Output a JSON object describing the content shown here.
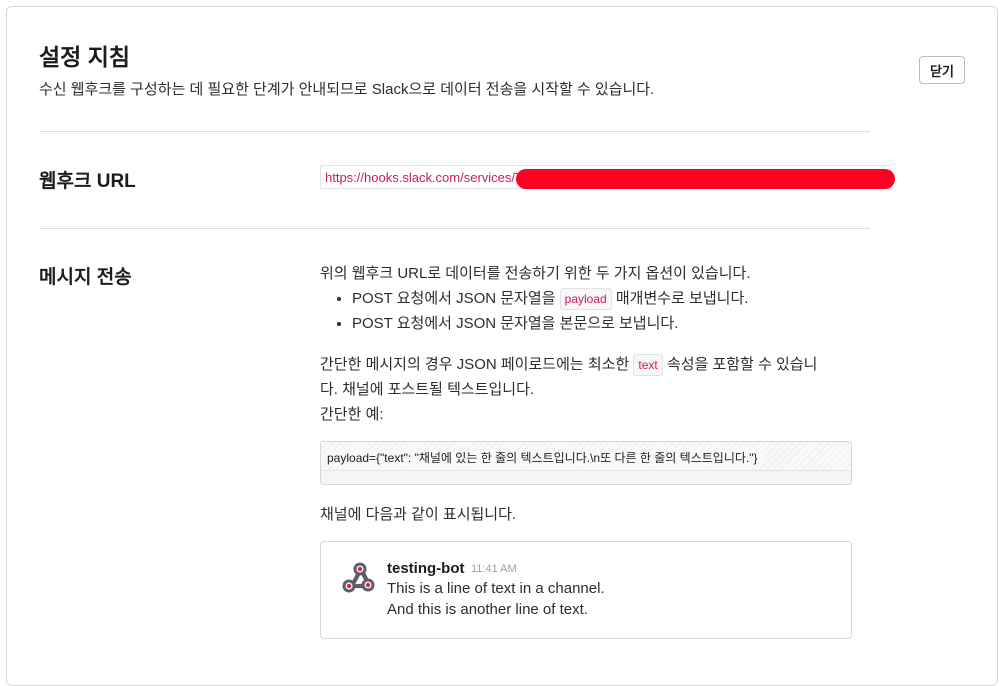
{
  "header": {
    "title": "설정 지침",
    "subtitle": "수신 웹후크를 구성하는 데 필요한 단계가 안내되므로 Slack으로 데이터 전송을 시작할 수 있습니다.",
    "close_label": "닫기"
  },
  "webhook": {
    "heading": "웹후크 URL",
    "url": "https://hooks.slack.com/services/T"
  },
  "send": {
    "heading": "메시지 전송",
    "intro": "위의 웹후크 URL로 데이터를 전송하기 위한 두 가지 옵션이 있습니다.",
    "bullet1_pre": "POST 요청에서 JSON 문자열을",
    "bullet1_code": "payload",
    "bullet1_post": "매개변수로 보냅니다.",
    "bullet2": "POST 요청에서 JSON 문자열을 본문으로 보냅니다.",
    "para_pre": "간단한 메시지의 경우 JSON 페이로드에는 최소한",
    "para_code": "text",
    "para_post_line1": "속성을 포함할 수 있습니",
    "para_line2": "다. 채널에 포스트될 텍스트입니다.",
    "example_label": "간단한 예:",
    "code_example": "payload={\"text\": \"채널에 있는 한 줄의 텍스트입니다.\\n또 다른 한 줄의 텍스트입니다.\"}",
    "display_label": "채널에 다음과 같이 표시됩니다."
  },
  "preview": {
    "icon": "webhook-icon",
    "bot_name": "testing-bot",
    "time": "11:41 AM",
    "line1": "This is a line of text in a channel.",
    "line2": "And this is another line of text."
  },
  "colors": {
    "code_text": "#c91d58",
    "redaction": "#ff0022"
  }
}
